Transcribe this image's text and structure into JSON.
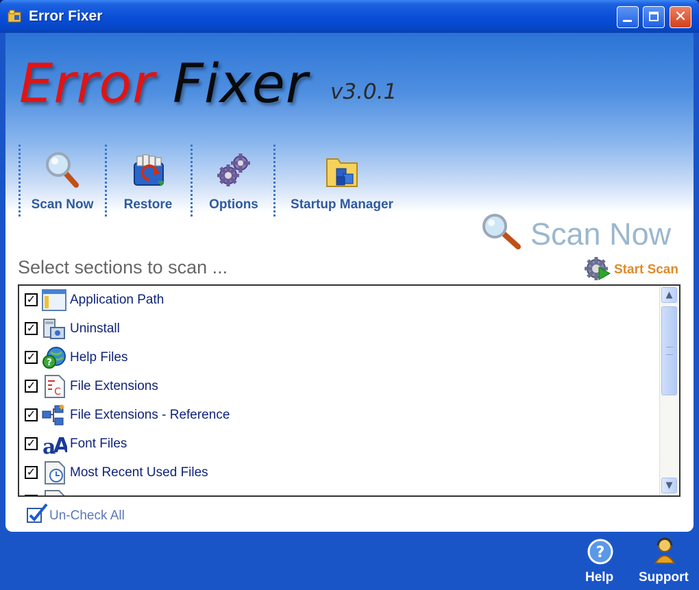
{
  "window": {
    "title": "Error Fixer"
  },
  "logo": {
    "word1": "Error",
    "word2": "Fixer",
    "version": "v3.0.1"
  },
  "toolbar": {
    "items": [
      {
        "label": "Scan Now",
        "icon": "magnifier-icon"
      },
      {
        "label": "Restore",
        "icon": "restore-icon"
      },
      {
        "label": "Options",
        "icon": "gears-icon"
      },
      {
        "label": "Startup Manager",
        "icon": "startup-folder-icon"
      }
    ]
  },
  "main": {
    "heading": "Scan Now",
    "select_prompt": "Select sections to scan ...",
    "start_scan_label": "Start Scan"
  },
  "sections": [
    {
      "label": "Application Path",
      "checked": true,
      "icon": "application-window-icon"
    },
    {
      "label": "Uninstall",
      "checked": true,
      "icon": "uninstall-icon"
    },
    {
      "label": "Help Files",
      "checked": true,
      "icon": "help-globe-icon"
    },
    {
      "label": "File Extensions",
      "checked": true,
      "icon": "file-extension-icon"
    },
    {
      "label": "File Extensions - Reference",
      "checked": true,
      "icon": "file-reference-icon"
    },
    {
      "label": "Font Files",
      "checked": true,
      "icon": "font-icon"
    },
    {
      "label": "Most Recent Used Files",
      "checked": true,
      "icon": "recent-files-icon"
    }
  ],
  "uncheck_all_label": "Un-Check All",
  "footer": {
    "help_label": "Help",
    "support_label": "Support"
  },
  "colors": {
    "accent": "#2f5a9e",
    "logo_red": "#e01414",
    "start_scan": "#e08a2a",
    "titlebar": "#0a4fd8"
  }
}
